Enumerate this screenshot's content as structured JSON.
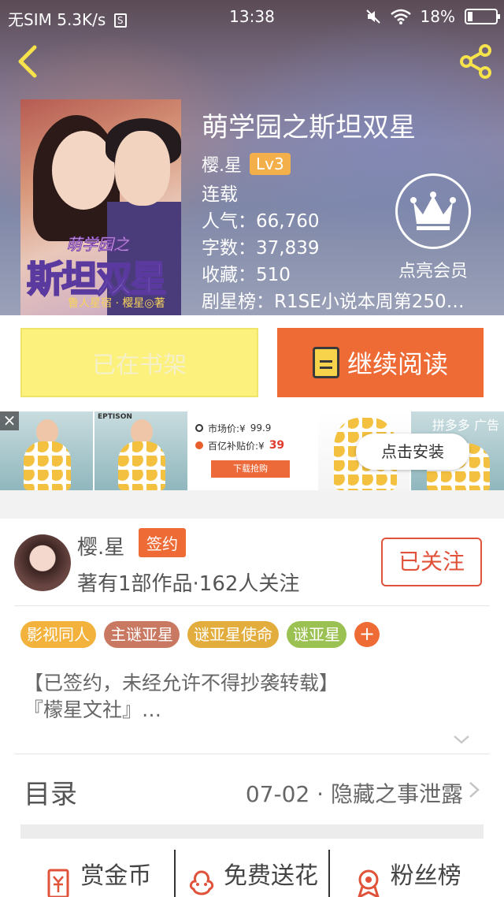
{
  "status_bar": {
    "carrier": "无SIM",
    "speed": "5.3K/s",
    "sim_icon_letter": "S",
    "time": "13:38",
    "battery": "18%"
  },
  "book": {
    "title": "萌学园之斯坦双星",
    "author": "樱.星",
    "level": "Lv3",
    "status": "连载",
    "popularity": "人气：66,760",
    "words": "字数：37,839",
    "favorites": "收藏：510",
    "ranking": "剧星榜：R1SE小说本周第250…",
    "cover": {
      "small_title": "萌学园之",
      "big_title": "斯坦双星",
      "sub": "鲁人星宿 · 樱星◎著"
    }
  },
  "vip": {
    "label": "点亮会员"
  },
  "buttons": {
    "shelf": "已在书架",
    "read": "继续阅读"
  },
  "ad": {
    "brand": "EPTISON",
    "market_price_label": "市场价:¥",
    "market_price": "99.9",
    "subsidy_label": "百亿补贴价:¥",
    "subsidy_price": "39",
    "download": "下载抢购",
    "install": "点击安装",
    "tag": "拼多多  广告",
    "close": "×"
  },
  "author_card": {
    "name": "樱.星",
    "badge": "签约",
    "meta": "著有1部作品·162人关注",
    "follow": "已关注"
  },
  "tags": [
    {
      "label": "影视同人",
      "color": "#f3b23c"
    },
    {
      "label": "主谜亚星",
      "color": "#c97862"
    },
    {
      "label": "谜亚星使命",
      "color": "#e3ad3d"
    },
    {
      "label": "谜亚星",
      "color": "#9cc153"
    }
  ],
  "description": {
    "line1": "【已签约，未经允许不得抄袭转载】",
    "line2": "『檬星文社』…"
  },
  "toc": {
    "label": "目录",
    "latest": "07-02 · 隐藏之事泄露"
  },
  "actions": [
    {
      "label": "赏金币",
      "icon": "coin-reward-icon"
    },
    {
      "label": "免费送花",
      "icon": "flower-icon"
    },
    {
      "label": "粉丝榜",
      "icon": "fan-rank-icon"
    }
  ],
  "colors": {
    "accent": "#ef6b36",
    "shelf_button": "#fbf17c",
    "follow": "#e0533a",
    "level_badge": "#f3b04a"
  }
}
